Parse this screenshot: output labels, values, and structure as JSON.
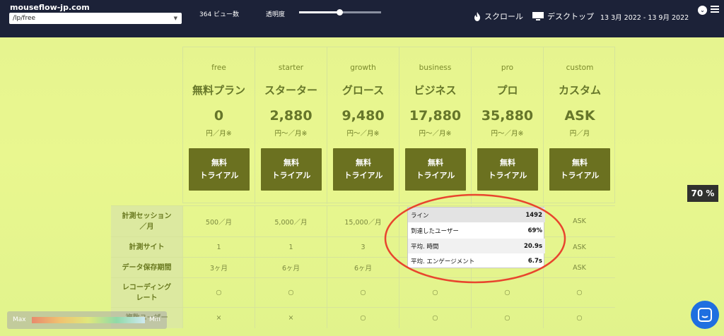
{
  "topbar": {
    "site": "mouseflow-jp.com",
    "url": "/lp/free",
    "views": "364 ビュー数",
    "opacity_label": "透明度",
    "opacity_level": 0.5,
    "scroll_label": "スクロール",
    "desktop_label": "デスクトップ",
    "date_range": "13 3月 2022 - 13 9月 2022"
  },
  "plans": [
    {
      "key": "free",
      "name": "無料プラン",
      "price": "0",
      "unit": "円／月※",
      "button": [
        "無料",
        "トライアル"
      ]
    },
    {
      "key": "starter",
      "name": "スターター",
      "price": "2,880",
      "unit": "円〜／月※",
      "button": [
        "無料",
        "トライアル"
      ]
    },
    {
      "key": "growth",
      "name": "グロース",
      "price": "9,480",
      "unit": "円〜／月※",
      "button": [
        "無料",
        "トライアル"
      ]
    },
    {
      "key": "business",
      "name": "ビジネス",
      "price": "17,880",
      "unit": "円〜／月※",
      "button": [
        "無料",
        "トライアル"
      ]
    },
    {
      "key": "pro",
      "name": "プロ",
      "price": "35,880",
      "unit": "円〜／月※",
      "button": [
        "無料",
        "トライアル"
      ]
    },
    {
      "key": "custom",
      "name": "カスタム",
      "price": "ASK",
      "unit": "円／月",
      "button": [
        "無料",
        "トライアル"
      ]
    }
  ],
  "scroll_percent": "70 %",
  "features": [
    {
      "label": [
        "計測セッション",
        "／月"
      ],
      "values": [
        "500／月",
        "5,000／月",
        "15,000／月",
        "",
        "",
        "ASK"
      ]
    },
    {
      "label": [
        "計測サイト"
      ],
      "values": [
        "1",
        "1",
        "3",
        "",
        "",
        "ASK"
      ]
    },
    {
      "label": [
        "データ保存期間"
      ],
      "values": [
        "3ヶ月",
        "6ヶ月",
        "6ヶ月",
        "",
        "",
        "ASK"
      ]
    },
    {
      "label": [
        "レコーディング",
        "レート"
      ],
      "values": [
        "○",
        "○",
        "○",
        "○",
        "○",
        "○"
      ]
    },
    {
      "label": [
        "複数ユーザー"
      ],
      "values": [
        "×",
        "×",
        "○",
        "○",
        "○",
        "○"
      ]
    }
  ],
  "tooltip": [
    {
      "label": "ライン",
      "value": "1492"
    },
    {
      "label": "到達したユーザー",
      "value": "69%"
    },
    {
      "label": "平均. 時間",
      "value": "20.9s"
    },
    {
      "label": "平均. エンゲージメント",
      "value": "6.7s"
    }
  ],
  "legend": {
    "max": "Max",
    "min": "Min"
  },
  "colors": {
    "topbar": "#1c2238",
    "button": "#6b7120",
    "circle": "#e8452e",
    "chat": "#1f6fe0"
  }
}
